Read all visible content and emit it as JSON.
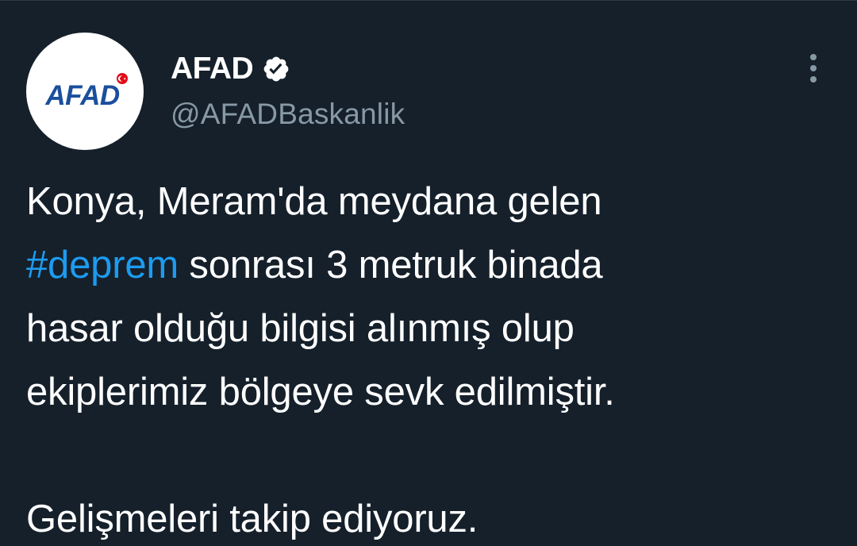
{
  "account": {
    "avatar_text": "AFAD",
    "display_name": "AFAD",
    "handle": "@AFADBaskanlik",
    "verified": true
  },
  "icons": {
    "verified": "verified-badge-icon",
    "more": "more-vertical-icon"
  },
  "tweet": {
    "line1": "Konya, Meram'da meydana gelen",
    "hashtag": "#deprem",
    "line2_rest": " sonrası 3 metruk binada",
    "line3": "hasar olduğu bilgisi alınmış olup",
    "line4": "ekiplerimiz bölgeye sevk edilmiştir.",
    "line6": "Gelişmeleri takip ediyoruz."
  },
  "colors": {
    "background": "#15202b",
    "text": "#ffffff",
    "secondary_text": "#8899a6",
    "link": "#1d9bf0",
    "logo_blue": "#1b4f9c",
    "logo_red": "#e30a17"
  }
}
